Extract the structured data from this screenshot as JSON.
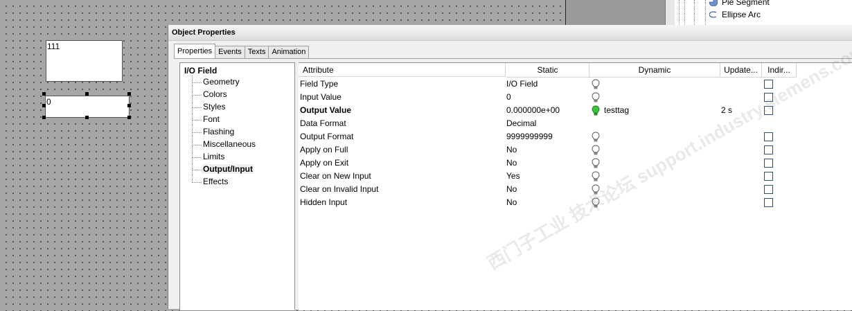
{
  "canvas": {
    "field_1_value": "111",
    "field_2_value": "0"
  },
  "toolbox": {
    "items": [
      {
        "label": "Pie Segment",
        "icon": "pie-segment-icon"
      },
      {
        "label": "Ellipse Arc",
        "icon": "ellipse-arc-icon"
      }
    ]
  },
  "dialog": {
    "title": "Object Properties",
    "tabs": [
      "Properties",
      "Events",
      "Texts",
      "Animation"
    ],
    "active_tab": "Properties",
    "tree": {
      "root": "I/O Field",
      "items": [
        "Geometry",
        "Colors",
        "Styles",
        "Font",
        "Flashing",
        "Miscellaneous",
        "Limits",
        "Output/Input",
        "Effects"
      ],
      "selected": "Output/Input"
    },
    "table": {
      "headers": [
        "Attribute",
        "Static",
        "Dynamic",
        "Update...",
        "Indir..."
      ],
      "rows": [
        {
          "attribute": "Field Type",
          "static": "I/O Field",
          "dynamic": "",
          "bulb": "bulb-off-icon",
          "update": "",
          "indirect": true,
          "bold": false
        },
        {
          "attribute": "Input Value",
          "static": "0",
          "dynamic": "",
          "bulb": "bulb-off-icon",
          "update": "",
          "indirect": true,
          "bold": false
        },
        {
          "attribute": "Output Value",
          "static": "0.000000e+00",
          "dynamic": "testtag",
          "bulb": "bulb-green-icon",
          "update": "2 s",
          "indirect": true,
          "bold": true
        },
        {
          "attribute": "Data Format",
          "static": "Decimal",
          "dynamic": "",
          "bulb": "",
          "update": "",
          "indirect": false,
          "bold": false
        },
        {
          "attribute": "Output Format",
          "static": "9999999999",
          "dynamic": "",
          "bulb": "bulb-off-icon",
          "update": "",
          "indirect": true,
          "bold": false
        },
        {
          "attribute": "Apply on Full",
          "static": "No",
          "dynamic": "",
          "bulb": "bulb-off-icon",
          "update": "",
          "indirect": true,
          "bold": false
        },
        {
          "attribute": "Apply on Exit",
          "static": "No",
          "dynamic": "",
          "bulb": "bulb-off-icon",
          "update": "",
          "indirect": true,
          "bold": false
        },
        {
          "attribute": "Clear on New Input",
          "static": "Yes",
          "dynamic": "",
          "bulb": "bulb-off-icon",
          "update": "",
          "indirect": true,
          "bold": false
        },
        {
          "attribute": "Clear on Invalid Input",
          "static": "No",
          "dynamic": "",
          "bulb": "bulb-off-icon",
          "update": "",
          "indirect": true,
          "bold": false
        },
        {
          "attribute": "Hidden Input",
          "static": "No",
          "dynamic": "",
          "bulb": "bulb-off-icon",
          "update": "",
          "indirect": true,
          "bold": false
        }
      ]
    }
  },
  "watermark": "西门子工业 技术论坛 support.industry.siemens.com",
  "colors": {
    "canvas_bg": "#a6a6a6",
    "dialog_bg": "#f0f0f0",
    "bulb_green": "#3cc43c",
    "checkbox_border": "#2b4d79"
  }
}
